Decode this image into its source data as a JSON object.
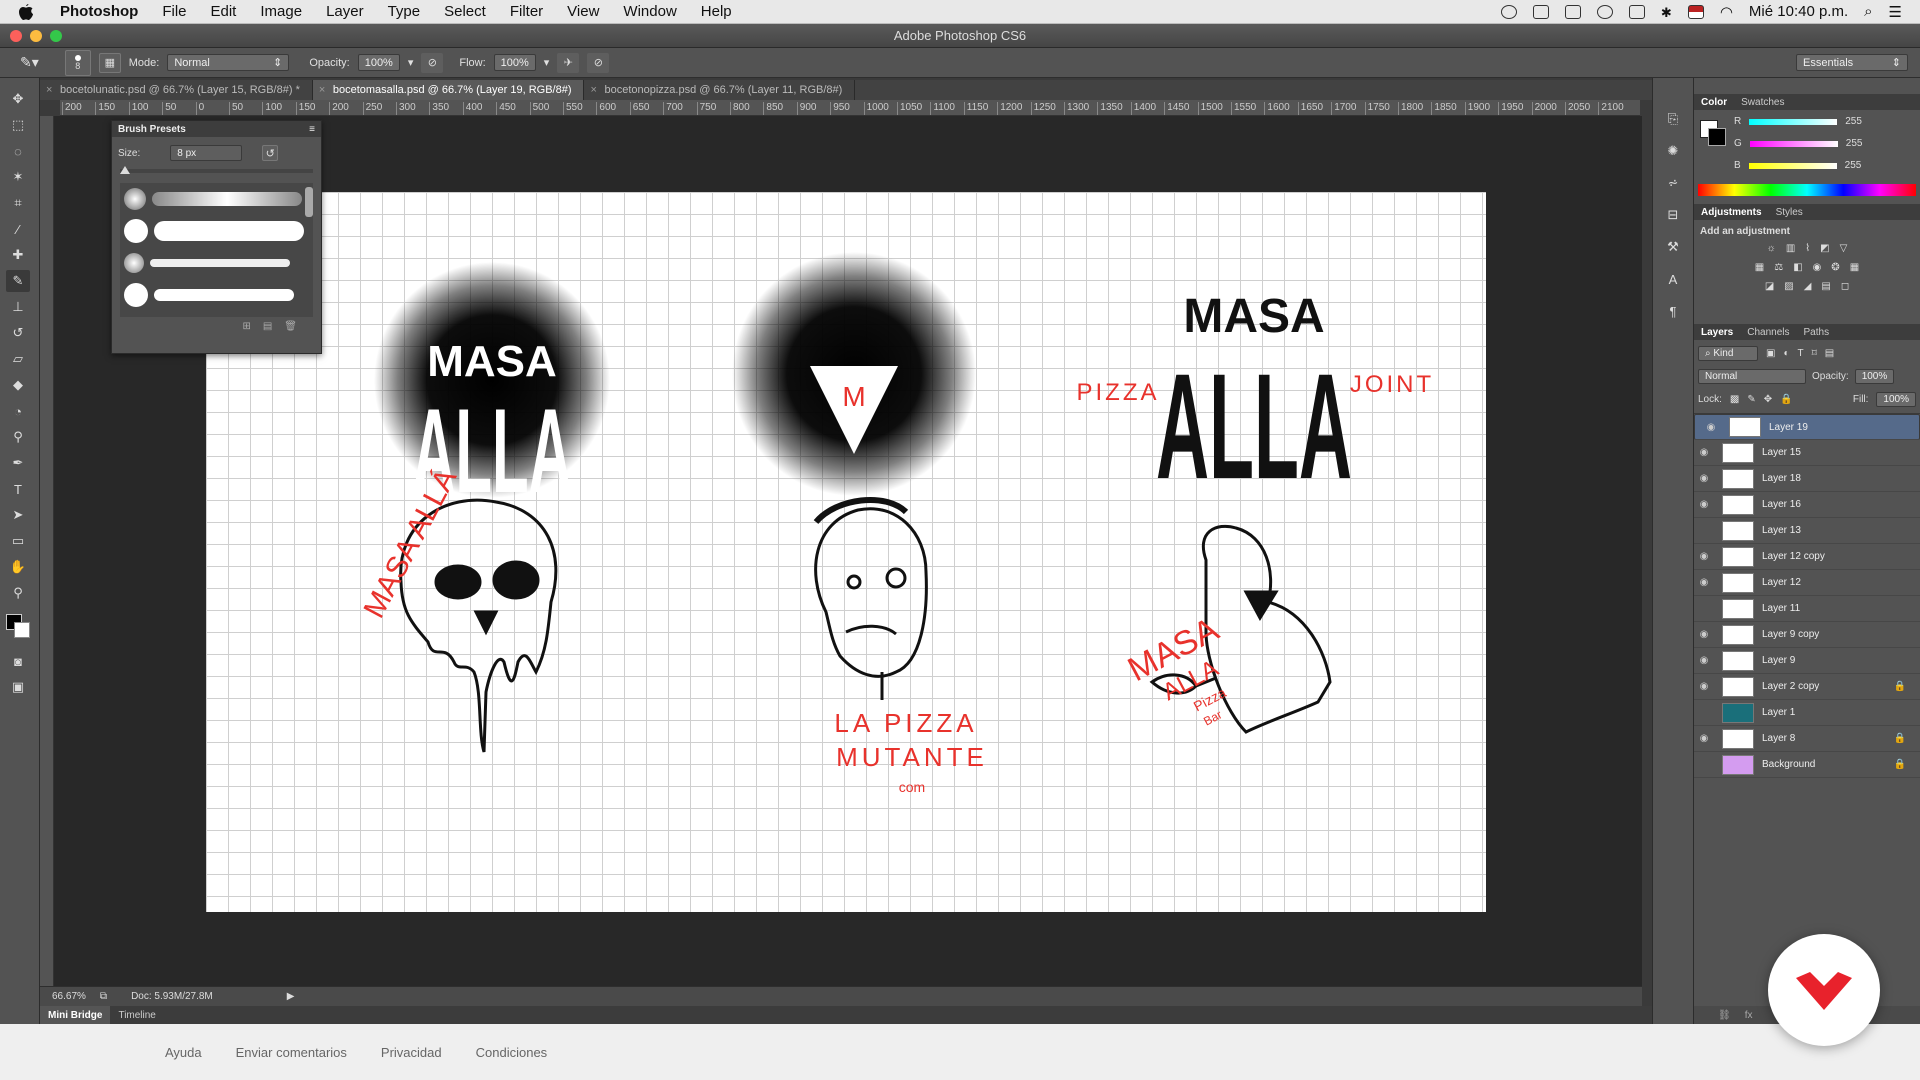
{
  "menubar": {
    "app": "Photoshop",
    "items": [
      "File",
      "Edit",
      "Image",
      "Layer",
      "Type",
      "Select",
      "Filter",
      "View",
      "Window",
      "Help"
    ],
    "clock": "Mié 10:40 p.m."
  },
  "window": {
    "title": "Adobe Photoshop CS6"
  },
  "options": {
    "brush_size": "8",
    "mode_label": "Mode:",
    "mode": "Normal",
    "opacity_label": "Opacity:",
    "opacity": "100%",
    "flow_label": "Flow:",
    "flow": "100%",
    "workspace": "Essentials"
  },
  "tabs": [
    {
      "label": "bocetolunatic.psd @ 66.7% (Layer 15, RGB/8#) *"
    },
    {
      "label": "bocetomasalla.psd @ 66.7% (Layer 19, RGB/8#)"
    },
    {
      "label": "bocetonopizza.psd @ 66.7% (Layer 11, RGB/8#)"
    }
  ],
  "ruler_ticks": [
    "200",
    "150",
    "100",
    "50",
    "0",
    "50",
    "100",
    "150",
    "200",
    "250",
    "300",
    "350",
    "400",
    "450",
    "500",
    "550",
    "600",
    "650",
    "700",
    "750",
    "800",
    "850",
    "900",
    "950",
    "1000",
    "1050",
    "1100",
    "1150",
    "1200",
    "1250",
    "1300",
    "1350",
    "1400",
    "1450",
    "1500",
    "1550",
    "1600",
    "1650",
    "1700",
    "1750",
    "1800",
    "1850",
    "1900",
    "1950",
    "2000",
    "2050",
    "2100"
  ],
  "brush_presets": {
    "title": "Brush Presets",
    "size_label": "Size:",
    "size_value": "8 px"
  },
  "color_panel": {
    "tabs": [
      "Color",
      "Swatches"
    ],
    "r_label": "R",
    "r": "255",
    "g_label": "G",
    "g": "255",
    "b_label": "B",
    "b": "255"
  },
  "adjustments": {
    "tabs": [
      "Adjustments",
      "Styles"
    ],
    "hint": "Add an adjustment"
  },
  "layers_panel": {
    "tabs": [
      "Layers",
      "Channels",
      "Paths"
    ],
    "kind": "Kind",
    "blend": "Normal",
    "opacity_label": "Opacity:",
    "opacity": "100%",
    "lock_label": "Lock:",
    "fill_label": "Fill:",
    "fill": "100%",
    "layers": [
      {
        "name": "Layer 19",
        "visible": true,
        "selected": true,
        "thumb": "#ffffff"
      },
      {
        "name": "Layer 15",
        "visible": true,
        "thumb": "#ffffff"
      },
      {
        "name": "Layer 18",
        "visible": true,
        "thumb": "#ffffff"
      },
      {
        "name": "Layer 16",
        "visible": true,
        "thumb": "#ffffff"
      },
      {
        "name": "Layer 13",
        "visible": false,
        "thumb": "#ffffff"
      },
      {
        "name": "Layer 12 copy",
        "visible": true,
        "thumb": "#ffffff"
      },
      {
        "name": "Layer 12",
        "visible": true,
        "thumb": "#ffffff"
      },
      {
        "name": "Layer 11",
        "visible": false,
        "thumb": "#ffffff"
      },
      {
        "name": "Layer 9 copy",
        "visible": true,
        "thumb": "#ffffff"
      },
      {
        "name": "Layer 9",
        "visible": true,
        "thumb": "#ffffff"
      },
      {
        "name": "Layer 2 copy",
        "visible": true,
        "locked": true,
        "thumb": "#ffffff"
      },
      {
        "name": "Layer 1",
        "visible": false,
        "thumb": "#1a6f7a"
      },
      {
        "name": "Layer 8",
        "visible": true,
        "locked": true,
        "thumb": "#ffffff"
      },
      {
        "name": "Background",
        "visible": false,
        "locked": true,
        "thumb": "#d49cf0"
      }
    ]
  },
  "canvas": {
    "logo1": {
      "top": "MASA",
      "bottom": "ALLA"
    },
    "logo2": {
      "letter": "M"
    },
    "logo3": {
      "left": "PIZZA",
      "top": "MASA",
      "bottom": "ALLA",
      "right": "JOINT"
    },
    "sketch1": {
      "text": "MASA ALLÁ"
    },
    "sketch2": {
      "line1": "LA PIZZA",
      "line2": "MUTANTE",
      "line3": "com"
    },
    "sketch3": {
      "line1": "MASA",
      "line2": "ALLA",
      "line3": "Pizza",
      "line4": "Bar"
    }
  },
  "status": {
    "zoom": "66.67%",
    "doc": "Doc: 5.93M/27.8M"
  },
  "bottom_tabs": [
    "Mini Bridge",
    "Timeline"
  ],
  "footer": [
    "Ayuda",
    "Enviar comentarios",
    "Privacidad",
    "Condiciones"
  ],
  "colors": {
    "accent_red": "#e8322c",
    "ink": "#111111",
    "selection": "#556a8a"
  }
}
